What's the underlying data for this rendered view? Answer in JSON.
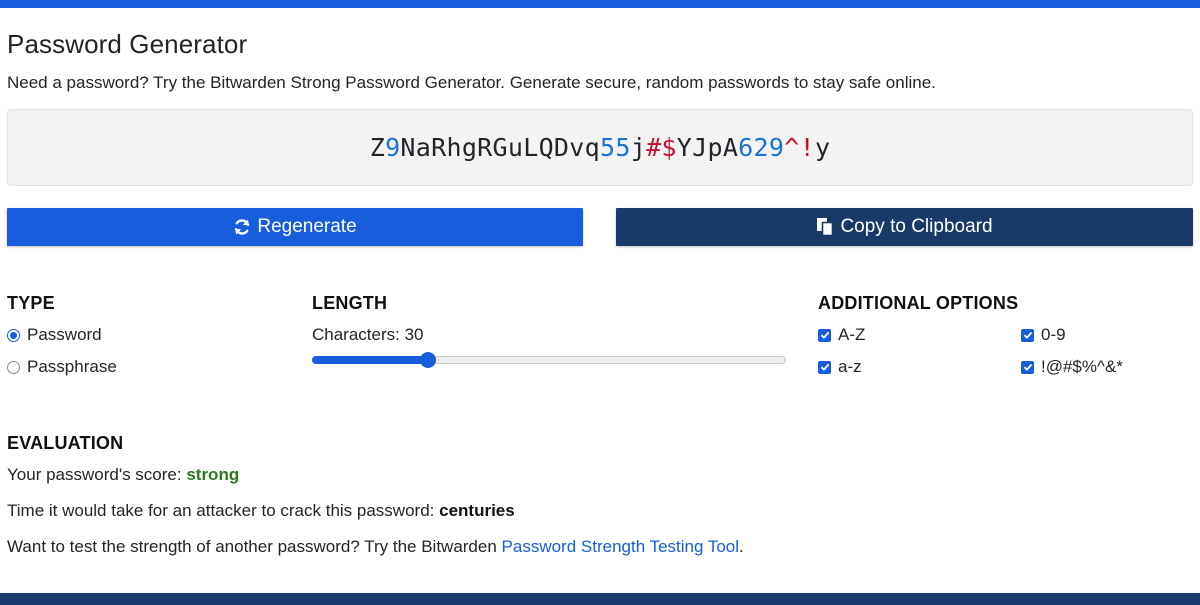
{
  "header": {
    "title": "Password Generator",
    "subtitle": "Need a password? Try the Bitwarden Strong Password Generator. Generate secure, random passwords to stay safe online."
  },
  "password": {
    "segments": [
      {
        "text": "Z",
        "kind": "letter"
      },
      {
        "text": "9",
        "kind": "num"
      },
      {
        "text": "NaRhgRGuLQDvq",
        "kind": "letter"
      },
      {
        "text": "55",
        "kind": "num"
      },
      {
        "text": "j",
        "kind": "letter"
      },
      {
        "text": "#$",
        "kind": "sym"
      },
      {
        "text": "YJpA",
        "kind": "letter"
      },
      {
        "text": "629",
        "kind": "num"
      },
      {
        "text": "^!",
        "kind": "sym"
      },
      {
        "text": "y",
        "kind": "letter"
      }
    ]
  },
  "buttons": {
    "regenerate_label": "Regenerate",
    "copy_label": "Copy to Clipboard"
  },
  "type": {
    "heading": "TYPE",
    "options": [
      {
        "label": "Password",
        "selected": true
      },
      {
        "label": "Passphrase",
        "selected": false
      }
    ]
  },
  "length": {
    "heading": "LENGTH",
    "label": "Characters: 30",
    "value": 30,
    "min": 5,
    "max": 128
  },
  "additional_options": {
    "heading": "ADDITIONAL OPTIONS",
    "options": [
      {
        "label": "A-Z",
        "checked": true
      },
      {
        "label": "0-9",
        "checked": true
      },
      {
        "label": "a-z",
        "checked": true
      },
      {
        "label": "!@#$%^&*",
        "checked": true
      }
    ]
  },
  "evaluation": {
    "heading": "EVALUATION",
    "score_prefix": "Your password's score: ",
    "score_value": "strong",
    "crack_prefix": "Time it would take for an attacker to crack this password: ",
    "crack_value": "centuries",
    "test_prefix": "Want to test the strength of another password? Try the Bitwarden ",
    "test_link": "Password Strength Testing Tool",
    "test_suffix": "."
  },
  "colors": {
    "accent": "#175ddc",
    "dark_button": "#193a68",
    "number": "#1a72d8",
    "symbol": "#c8102e",
    "strong": "#2a7a1f"
  },
  "icons": {
    "regenerate": "refresh-icon",
    "copy": "copy-icon"
  }
}
